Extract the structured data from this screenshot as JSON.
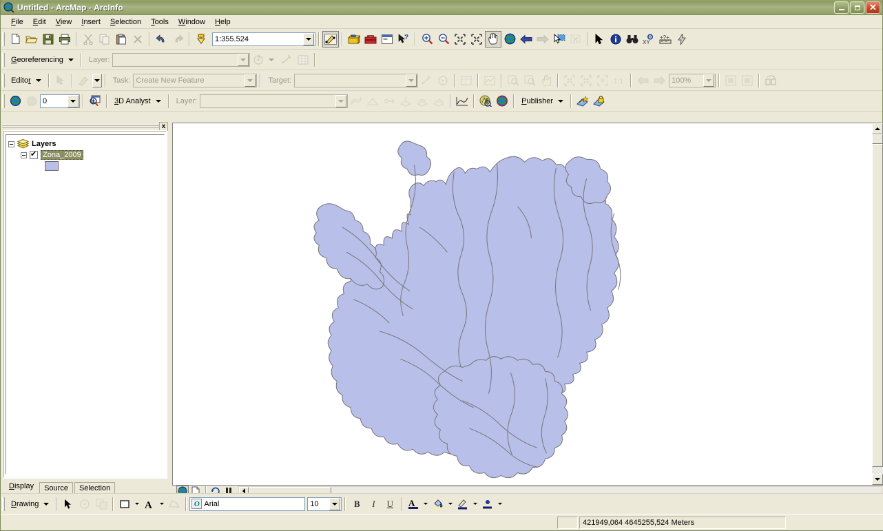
{
  "window": {
    "title": "Untitled - ArcMap - ArcInfo",
    "app_icon": "globe-magnifier-icon",
    "minimize_label": "Minimize",
    "restore_label": "Restore",
    "close_label": "Close"
  },
  "menubar": {
    "items": [
      {
        "label": "File",
        "accel": "F"
      },
      {
        "label": "Edit",
        "accel": "E"
      },
      {
        "label": "View",
        "accel": "V"
      },
      {
        "label": "Insert",
        "accel": "I"
      },
      {
        "label": "Selection",
        "accel": "S"
      },
      {
        "label": "Tools",
        "accel": "T"
      },
      {
        "label": "Window",
        "accel": "W"
      },
      {
        "label": "Help",
        "accel": "H"
      }
    ]
  },
  "standard_toolbar": {
    "scale_value": "1:355.524",
    "buttons": [
      "new-document-icon",
      "open-folder-icon",
      "save-icon",
      "print-icon",
      "cut-scissors-icon",
      "copy-icon",
      "paste-icon",
      "delete-x-icon",
      "undo-arrow-icon",
      "redo-arrow-icon",
      "add-data-icon"
    ],
    "right_buttons": [
      "editor-toolbar-icon",
      "arctoolbox-icon",
      "toolbox-red-icon",
      "command-line-icon",
      "whats-this-help-icon",
      "zoom-in-icon",
      "zoom-out-icon",
      "fixed-zoom-in-icon",
      "fixed-zoom-out-icon",
      "pan-hand-icon",
      "full-extent-globe-icon",
      "back-extent-icon",
      "forward-extent-icon",
      "select-features-icon",
      "clear-selection-icon",
      "select-elements-arrow-icon",
      "identify-icon",
      "find-binoculars-icon",
      "go-to-xy-icon",
      "measure-icon",
      "hyperlink-icon"
    ]
  },
  "georeferencing_toolbar": {
    "menu_label": "Georeferencing",
    "layer_label": "Layer:",
    "layer_value": "",
    "layer_placeholder": "",
    "buttons": [
      "rotate-icon",
      "rotate-dropdown",
      "add-control-points-icon",
      "view-link-table-icon"
    ]
  },
  "editor_toolbar": {
    "menu_label": "Editor",
    "task_label": "Task:",
    "task_value": "Create New Feature",
    "target_label": "Target:",
    "target_value": "",
    "zoom_value": "100%",
    "buttons": [
      "edit-arrow-icon",
      "sketch-pencil-icon",
      "sketch-dropdown",
      "split-icon",
      "rotate-edit-icon",
      "attributes-icon",
      "sketch-properties-icon",
      "zoom-in-raster-icon",
      "zoom-out-raster-icon",
      "pan-raster-icon",
      "fit-to-display-icon",
      "zoom-to-extent-icon",
      "zoom-selected-icon",
      "actual-size-icon",
      "previous-raster-icon",
      "next-raster-icon",
      "effects-icon",
      "swipe-icon",
      "flicker-icon"
    ]
  },
  "analyst_toolbar": {
    "globe_icon": "globe-analysis-icon",
    "target_icon": "target-icon",
    "level_value": "0",
    "magnify_icon": "magnifier-window-icon",
    "menu_label": "3D Analyst",
    "layer_label": "Layer:",
    "layer_value": "",
    "right_icons": [
      "contour-icon",
      "slope-icon",
      "line-of-sight-icon",
      "steepest-path-icon",
      "area-volume-icon",
      "surface-icon",
      "profile-graph-icon",
      "arcscene-icon",
      "arcglobe-icon"
    ],
    "publisher_label": "Publisher",
    "publisher_icons": [
      "publish-map-icon",
      "set-data-restrictions-icon"
    ]
  },
  "toc": {
    "close_label": "x",
    "tree": {
      "root_label": "Layers",
      "root_icon": "layers-stack-icon",
      "layer_name": "Zona_2009",
      "layer_checked": true,
      "symbol_color": "#b8bfe8",
      "symbol_outline": "#6a6a6a"
    },
    "tabs": [
      {
        "label": "Display",
        "active": true,
        "accel": "D"
      },
      {
        "label": "Source",
        "active": false,
        "accel": "S"
      },
      {
        "label": "Selection",
        "active": false,
        "accel": "l"
      }
    ]
  },
  "map": {
    "background": "#ffffff",
    "polygon_fill": "#b8bfe8",
    "polygon_stroke": "#77757b",
    "bottom_buttons": [
      "data-view-icon",
      "layout-view-icon",
      "refresh-icon",
      "pause-drawing-icon"
    ]
  },
  "drawing_toolbar": {
    "menu_label": "Drawing",
    "select_icon": "select-arrow-icon",
    "rotate_icon": "rotate-element-icon",
    "group_icon": "group-elements-icon",
    "fill_icon": "fill-color-icon",
    "text_icon": "new-text-icon",
    "draw_icon": "draw-shape-icon",
    "font_name": "Arial",
    "font_size": "10",
    "bold_label": "B",
    "italic_label": "I",
    "underline_label": "U",
    "color_buttons": [
      "font-color-icon",
      "fill-color-icon",
      "line-color-icon",
      "marker-color-icon"
    ]
  },
  "statusbar": {
    "coordinates": "421949,064  4645255,524 Meters"
  },
  "chart_data": {
    "type": "map",
    "title": "Zona_2009",
    "layers": [
      {
        "name": "Zona_2009",
        "geometry": "polygon",
        "fill": "#b8bfe8",
        "stroke": "#77757b",
        "visible": true
      }
    ],
    "scale": "1:355.524",
    "units": "Meters",
    "cursor_position": {
      "x": "421949,064",
      "y": "4645255,524"
    }
  }
}
